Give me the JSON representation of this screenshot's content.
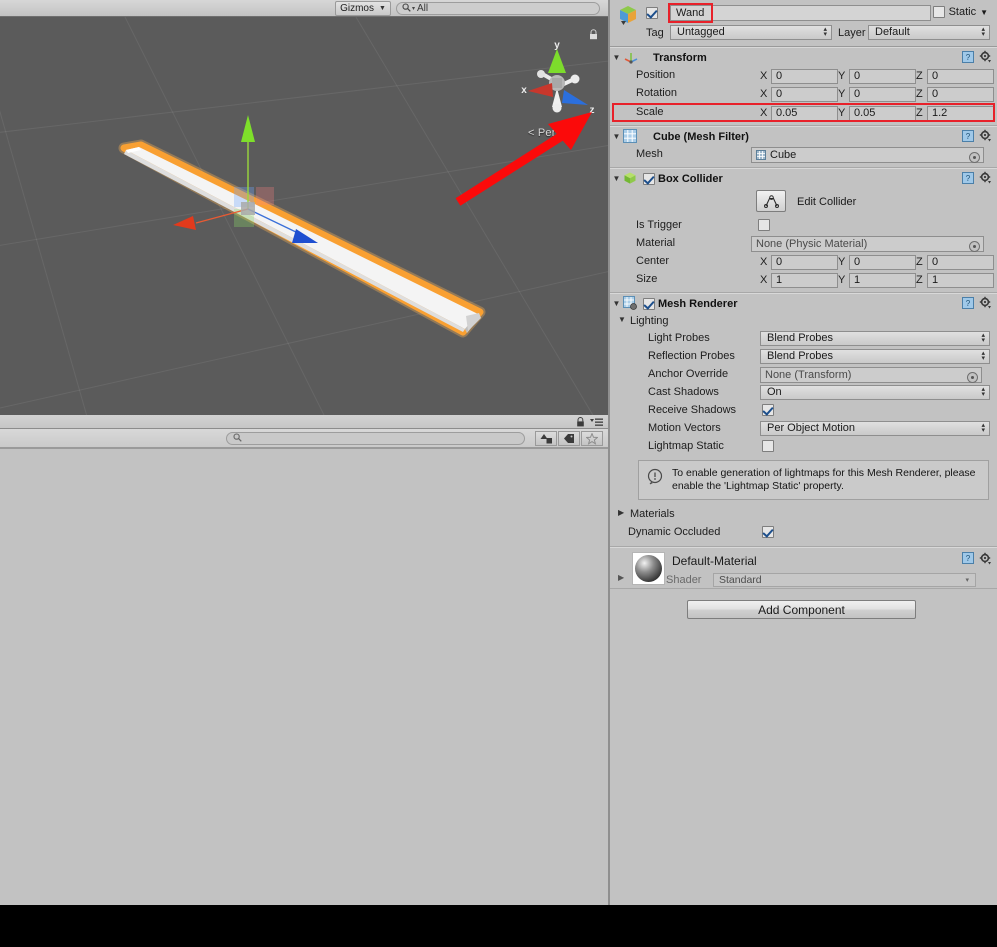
{
  "scene_toolbar": {
    "gizmos_label": "Gizmos",
    "gizmos_caret": "▼",
    "search_placeholder": "All",
    "search_value": "All",
    "search_icon": "Q"
  },
  "scene_view": {
    "perspective_label": "< Per",
    "axis_gizmo": {
      "x_label": "x",
      "y_label": "y",
      "z_label": "z",
      "x_color": "#c8372c",
      "y_color": "#7ddc2c",
      "z_color": "#2b6fdd"
    },
    "background_color": "#5b5b5b",
    "selection_outline_color": "#ff9a1f",
    "object_color": "#f2f2f2",
    "annotation_arrow_color": "#fb0a0a"
  },
  "project_panel": {
    "search_placeholder": "",
    "search_icon": "search-icon",
    "filter_buttons": [
      "type-filter",
      "label-filter",
      "favorite-filter"
    ]
  },
  "inspector": {
    "object_name": "Wand",
    "active_checked": true,
    "static_label": "Static",
    "static_checked": false,
    "static_arrow": "▼",
    "tag_label": "Tag",
    "tag_value": "Untagged",
    "layer_label": "Layer",
    "layer_value": "Default",
    "components": [
      {
        "id": "transform",
        "title": "Transform",
        "icon": "transform-icon",
        "expanded": true,
        "rows": [
          {
            "label": "Position",
            "x": "0",
            "y": "0",
            "z": "0"
          },
          {
            "label": "Rotation",
            "x": "0",
            "y": "0",
            "z": "0"
          },
          {
            "label": "Scale",
            "x": "0.05",
            "y": "0.05",
            "z": "1.2",
            "highlighted": true
          }
        ]
      },
      {
        "id": "mesh-filter",
        "title": "Cube (Mesh Filter)",
        "icon": "mesh-filter-icon",
        "expanded": true,
        "mesh_label": "Mesh",
        "mesh_value": "Cube"
      },
      {
        "id": "box-collider",
        "title": "Box Collider",
        "icon": "box-collider-icon",
        "enabled": true,
        "expanded": true,
        "edit_collider_label": "Edit Collider",
        "is_trigger_label": "Is Trigger",
        "is_trigger_checked": false,
        "material_label": "Material",
        "material_value": "None (Physic Material)",
        "center": {
          "label": "Center",
          "x": "0",
          "y": "0",
          "z": "0"
        },
        "size": {
          "label": "Size",
          "x": "1",
          "y": "1",
          "z": "1"
        }
      },
      {
        "id": "mesh-renderer",
        "title": "Mesh Renderer",
        "icon": "mesh-renderer-icon",
        "enabled": true,
        "expanded": true,
        "lighting_label": "Lighting",
        "light_probes_label": "Light Probes",
        "light_probes_value": "Blend Probes",
        "reflection_probes_label": "Reflection Probes",
        "reflection_probes_value": "Blend Probes",
        "anchor_override_label": "Anchor Override",
        "anchor_override_value": "None (Transform)",
        "cast_shadows_label": "Cast Shadows",
        "cast_shadows_value": "On",
        "receive_shadows_label": "Receive Shadows",
        "receive_shadows_checked": true,
        "motion_vectors_label": "Motion Vectors",
        "motion_vectors_value": "Per Object Motion",
        "lightmap_static_label": "Lightmap Static",
        "lightmap_static_checked": false,
        "info_text": "To enable generation of lightmaps for this Mesh Renderer, please enable the 'Lightmap Static' property.",
        "materials_label": "Materials",
        "dynamic_occluded_label": "Dynamic Occluded",
        "dynamic_occluded_checked": true
      }
    ],
    "material_block": {
      "name": "Default-Material",
      "shader_label": "Shader",
      "shader_value": "Standard"
    },
    "add_component_label": "Add Component"
  },
  "colors": {
    "panel_bg": "#c2c2c2",
    "viewport_bg": "#5b5b5b",
    "highlight_red": "#e8212a",
    "selection_orange": "#ff9a1f"
  }
}
